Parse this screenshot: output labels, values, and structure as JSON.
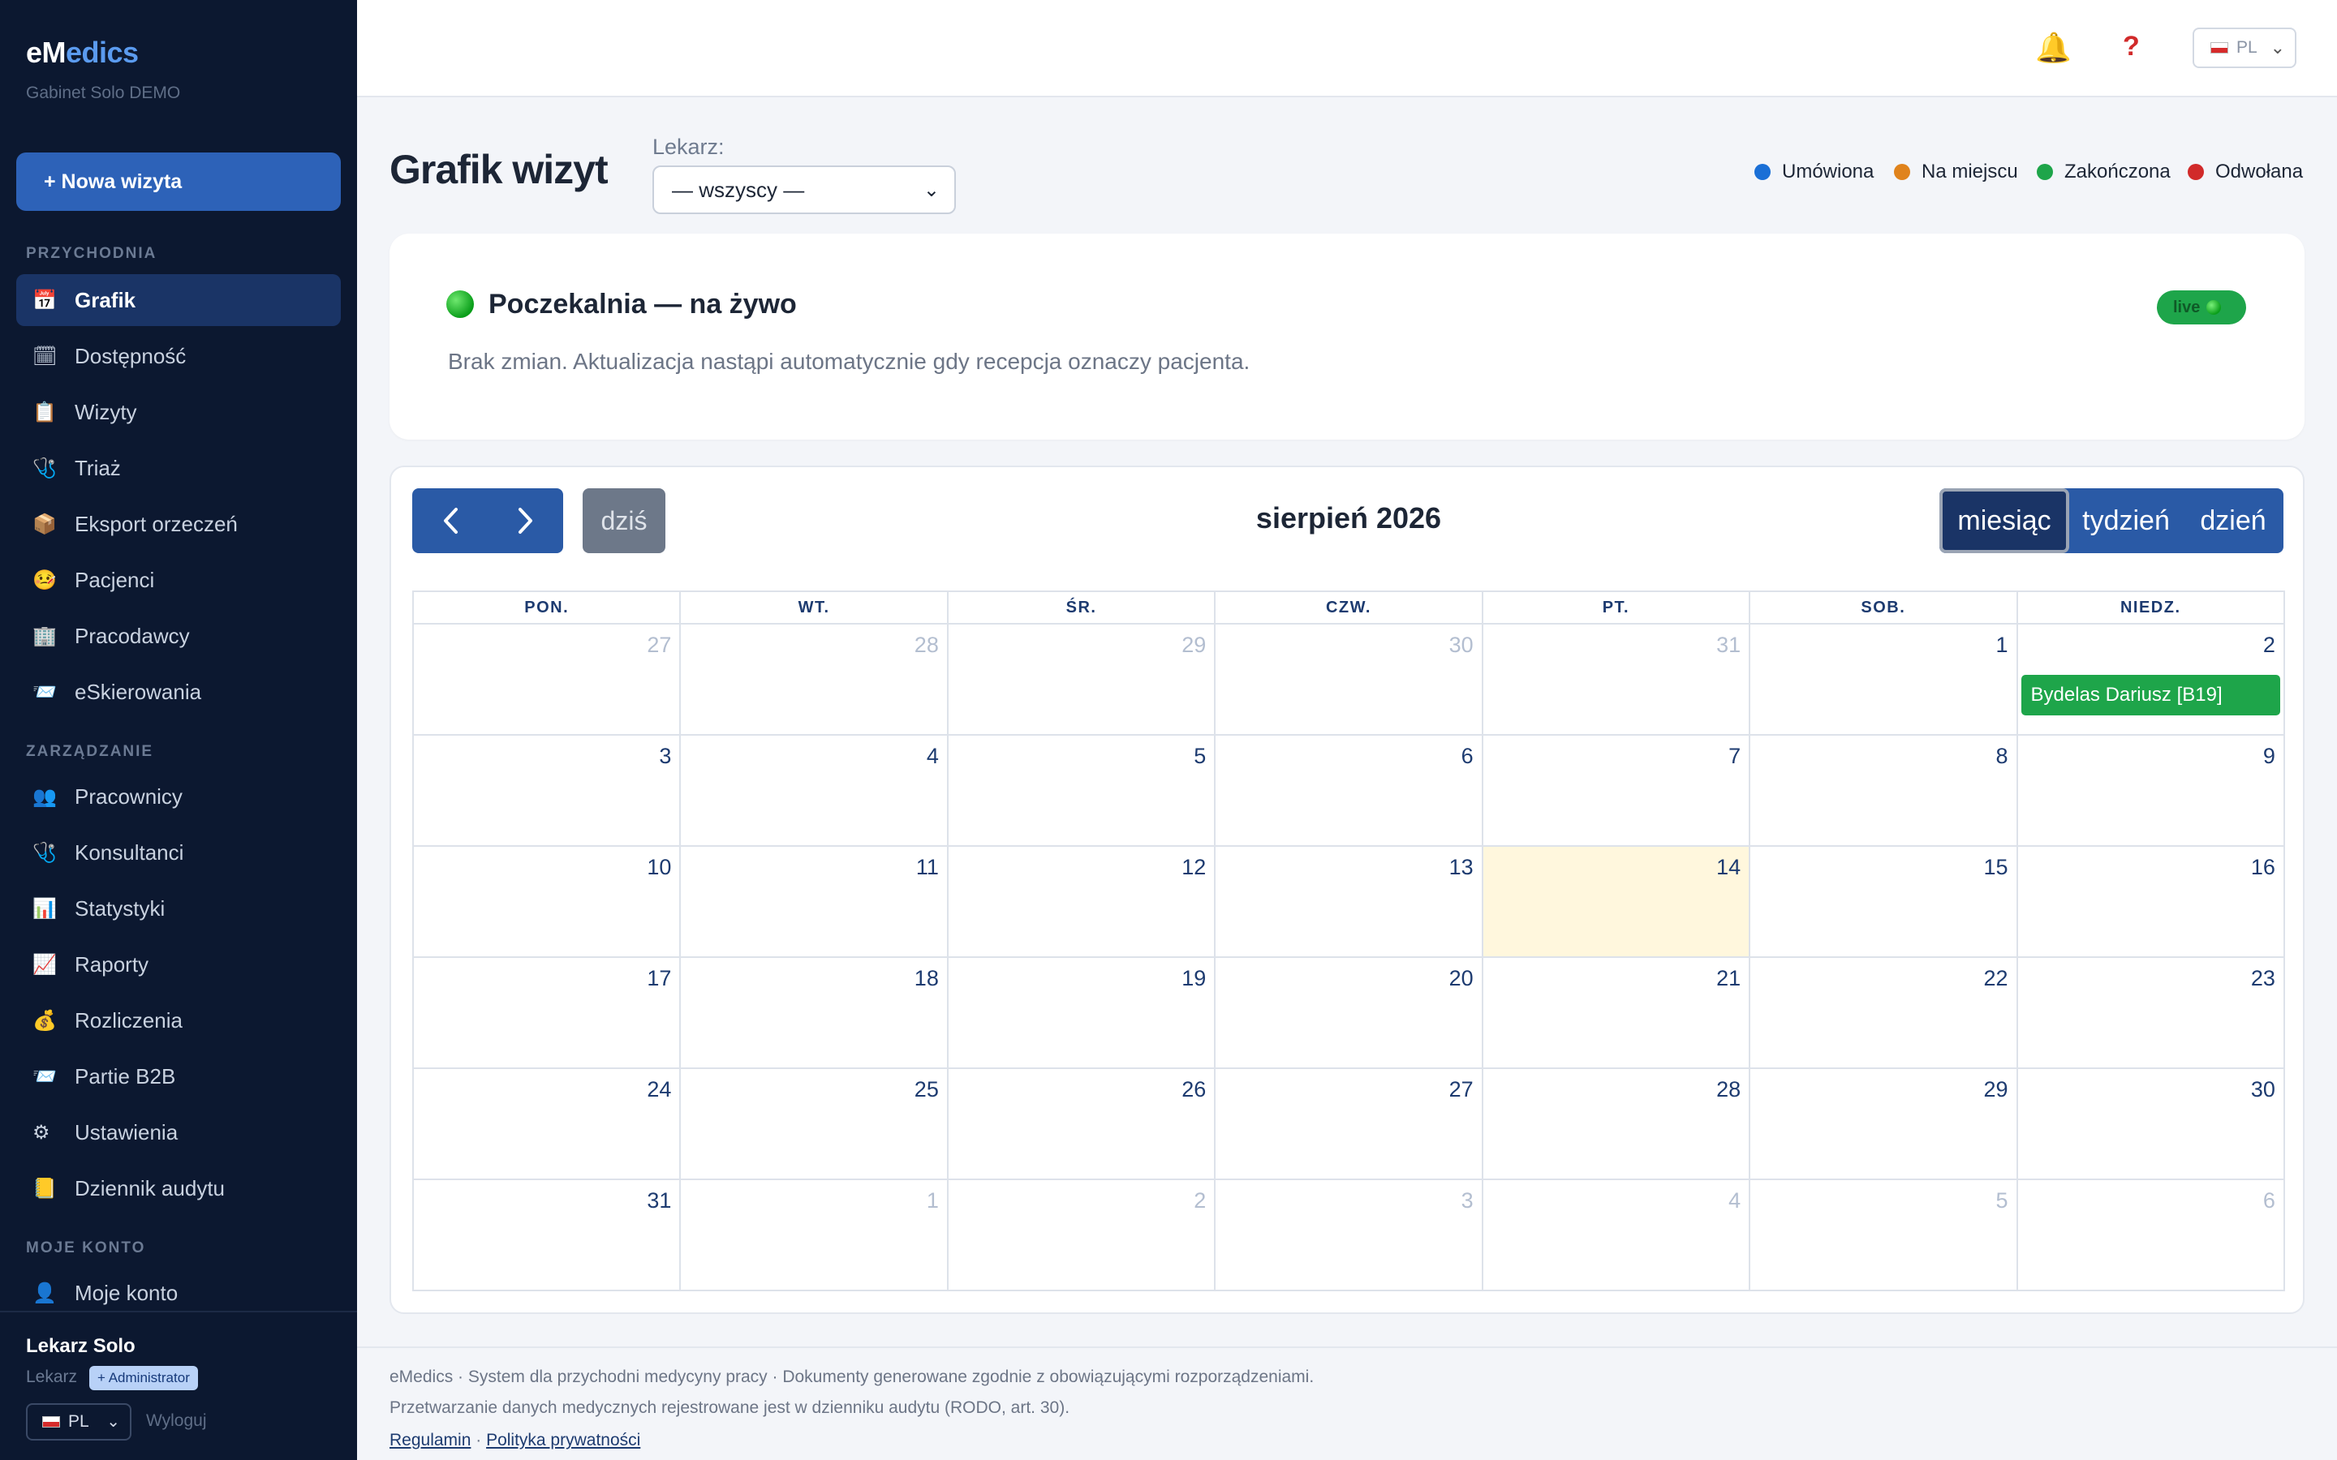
{
  "brand": {
    "prefix": "eM",
    "highlight": "edics",
    "clinic": "Gabinet Solo DEMO"
  },
  "sidebar": {
    "new_visit": "+ Nowa wizyta",
    "sections": [
      {
        "label": "PRZYCHODNIA"
      },
      {
        "label": "ZARZĄDZANIE"
      },
      {
        "label": "MOJE KONTO"
      }
    ],
    "items": [
      {
        "label": "Grafik",
        "icon": "calendar-icon",
        "glyph": "📅"
      },
      {
        "label": "Dostępność",
        "icon": "calendar-check-icon",
        "glyph": "🗓"
      },
      {
        "label": "Wizyty",
        "icon": "clipboard-icon",
        "glyph": "📋"
      },
      {
        "label": "Triaż",
        "icon": "stethoscope-icon",
        "glyph": "🩺"
      },
      {
        "label": "Eksport orzeczeń",
        "icon": "package-icon",
        "glyph": "📦"
      },
      {
        "label": "Pacjenci",
        "icon": "patient-face-icon",
        "glyph": "🤒"
      },
      {
        "label": "Pracodawcy",
        "icon": "building-icon",
        "glyph": "🏢"
      },
      {
        "label": "eSkierowania",
        "icon": "inbox-icon",
        "glyph": "📨"
      },
      {
        "label": "Pracownicy",
        "icon": "people-icon",
        "glyph": "👥"
      },
      {
        "label": "Konsultanci",
        "icon": "stethoscope-icon",
        "glyph": "🩺"
      },
      {
        "label": "Statystyki",
        "icon": "bar-chart-icon",
        "glyph": "📊"
      },
      {
        "label": "Raporty",
        "icon": "line-chart-icon",
        "glyph": "📈"
      },
      {
        "label": "Rozliczenia",
        "icon": "money-bag-icon",
        "glyph": "💰"
      },
      {
        "label": "Partie B2B",
        "icon": "inbox-icon",
        "glyph": "📨"
      },
      {
        "label": "Ustawienia",
        "icon": "gear-icon",
        "glyph": "⚙"
      },
      {
        "label": "Dziennik audytu",
        "icon": "ledger-icon",
        "glyph": "📒"
      },
      {
        "label": "Moje konto",
        "icon": "user-icon",
        "glyph": "👤"
      }
    ],
    "user": {
      "name": "Lekarz Solo",
      "role": "Lekarz",
      "badge": "+ Administrator",
      "lang": "PL",
      "logout": "Wyloguj"
    }
  },
  "topbar": {
    "lang": "PL",
    "help": "?",
    "bell": "🔔"
  },
  "page": {
    "title": "Grafik wizyt",
    "doctor_label": "Lekarz:",
    "doctor_value": "— wszyscy —",
    "legend": [
      {
        "label": "Umówiona",
        "color": "#1a6fd6"
      },
      {
        "label": "Na miejscu",
        "color": "#e0831c"
      },
      {
        "label": "Zakończona",
        "color": "#1ea54a"
      },
      {
        "label": "Odwołana",
        "color": "#d12a2a"
      }
    ]
  },
  "waiting_room": {
    "title": "Poczekalnia — na żywo",
    "text": "Brak zmian. Aktualizacja nastąpi automatycznie gdy recepcja oznaczy pacjenta.",
    "badge": "live"
  },
  "calendar": {
    "prev": "‹",
    "next": "›",
    "today": "dziś",
    "title": "sierpień 2026",
    "views": [
      "miesiąc",
      "tydzień",
      "dzień"
    ],
    "active_view": "miesiąc",
    "weekdays": [
      "PON.",
      "WT.",
      "ŚR.",
      "CZW.",
      "PT.",
      "SOB.",
      "NIEDZ."
    ],
    "weeks": [
      [
        {
          "d": "27",
          "o": true
        },
        {
          "d": "28",
          "o": true
        },
        {
          "d": "29",
          "o": true
        },
        {
          "d": "30",
          "o": true
        },
        {
          "d": "31",
          "o": true
        },
        {
          "d": "1"
        },
        {
          "d": "2",
          "event": "Bydelas Dariusz [B19]"
        }
      ],
      [
        {
          "d": "3"
        },
        {
          "d": "4"
        },
        {
          "d": "5"
        },
        {
          "d": "6"
        },
        {
          "d": "7"
        },
        {
          "d": "8"
        },
        {
          "d": "9"
        }
      ],
      [
        {
          "d": "10"
        },
        {
          "d": "11"
        },
        {
          "d": "12"
        },
        {
          "d": "13"
        },
        {
          "d": "14",
          "today": true
        },
        {
          "d": "15"
        },
        {
          "d": "16"
        }
      ],
      [
        {
          "d": "17"
        },
        {
          "d": "18"
        },
        {
          "d": "19"
        },
        {
          "d": "20"
        },
        {
          "d": "21"
        },
        {
          "d": "22"
        },
        {
          "d": "23"
        }
      ],
      [
        {
          "d": "24"
        },
        {
          "d": "25"
        },
        {
          "d": "26"
        },
        {
          "d": "27"
        },
        {
          "d": "28"
        },
        {
          "d": "29"
        },
        {
          "d": "30"
        }
      ],
      [
        {
          "d": "31"
        },
        {
          "d": "1",
          "o": true
        },
        {
          "d": "2",
          "o": true
        },
        {
          "d": "3",
          "o": true
        },
        {
          "d": "4",
          "o": true
        },
        {
          "d": "5",
          "o": true
        },
        {
          "d": "6",
          "o": true
        }
      ]
    ]
  },
  "footer": {
    "line1": "eMedics · System dla przychodni medycyny pracy · Dokumenty generowane zgodnie z obowiązującymi rozporządzeniami.",
    "line2": "Przetwarzanie danych medycznych rejestrowane jest w dzienniku audytu (RODO, art. 30).",
    "link1": "Regulamin",
    "sep": " · ",
    "link2": "Polityka prywatności"
  }
}
